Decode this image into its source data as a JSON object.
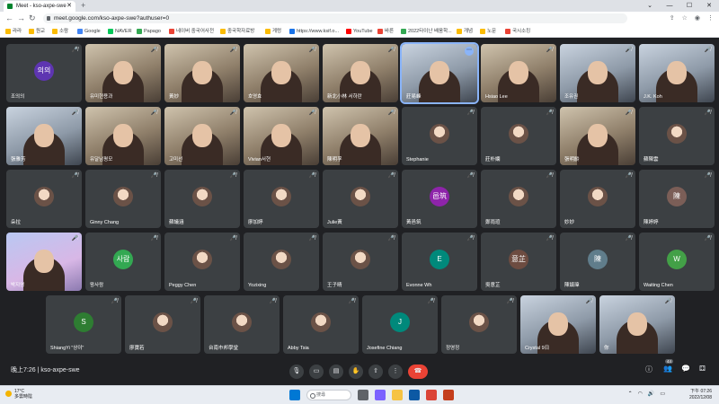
{
  "browser": {
    "tab_title": "Meet - kso-axpe-swe",
    "url": "meet.google.com/kso-axpe-swe?authuser=0",
    "bookmarks": [
      "라라",
      "원교",
      "소람",
      "Google",
      "NAVER",
      "Papago",
      "네이버 중국어사전",
      "중국학자료방",
      "게렁",
      "https://www.ksif.o...",
      "YouTube",
      "바른",
      "2022타이난 배움학...",
      "개념",
      "노문",
      "국시소킹"
    ]
  },
  "rows": [
    [
      {
        "type": "avatar",
        "initials": "의의",
        "color": "#5e35b1",
        "name": "조의의"
      },
      {
        "type": "video",
        "name": "유미현용과"
      },
      {
        "type": "video",
        "name": "黃妙"
      },
      {
        "type": "video",
        "name": "호영효"
      },
      {
        "type": "video",
        "name": "新北小林 서하란"
      },
      {
        "type": "video",
        "tone": "cool",
        "name": "莊易峰",
        "active": true
      },
      {
        "type": "video",
        "name": "Hsiao Lee"
      },
      {
        "type": "video",
        "tone": "cool",
        "name": "조유권"
      },
      {
        "type": "video",
        "tone": "cool",
        "name": "J.K. Koh"
      }
    ],
    [
      {
        "type": "video",
        "tone": "cool",
        "name": "張雅芳"
      },
      {
        "type": "video",
        "name": "유달남평모"
      },
      {
        "type": "video",
        "name": "고미선"
      },
      {
        "type": "video",
        "name": "Vivian서현"
      },
      {
        "type": "video",
        "name": "陳明孚"
      },
      {
        "type": "photo",
        "name": "Stephanie"
      },
      {
        "type": "photo",
        "name": "莊朴嫻"
      },
      {
        "type": "video",
        "name": "張明齡"
      },
      {
        "type": "photo",
        "name": "蘇陳雲"
      }
    ],
    [
      {
        "type": "photo",
        "name": "朵拉"
      },
      {
        "type": "photo",
        "name": "Ginny Chang"
      },
      {
        "type": "photo",
        "name": "蘇議涵"
      },
      {
        "type": "photo",
        "name": "廖加婷"
      },
      {
        "type": "photo",
        "name": "Julie黃"
      },
      {
        "type": "avatar",
        "initials": "邑筑",
        "color": "#8e24aa",
        "name": "黃邑筑"
      },
      {
        "type": "photo",
        "name": "鄭雨瑄"
      },
      {
        "type": "photo",
        "name": "妙妙"
      },
      {
        "type": "avatar",
        "initials": "陳",
        "color": "#7b5e57",
        "name": "陳婷婷"
      }
    ],
    [
      {
        "type": "video",
        "tone": "blue",
        "name": "박지영"
      },
      {
        "type": "avatar",
        "initials": "사람",
        "color": "#33a852",
        "name": "왕사람"
      },
      {
        "type": "photo",
        "name": "Peggy Chen"
      },
      {
        "type": "photo",
        "name": "Yozixing"
      },
      {
        "type": "photo",
        "name": "王子晴"
      },
      {
        "type": "avatar",
        "initials": "E",
        "color": "#00897b",
        "name": "Evonne Wh"
      },
      {
        "type": "avatar",
        "initials": "意芷",
        "color": "#6d4c41",
        "name": "吳意芷"
      },
      {
        "type": "avatar",
        "initials": "陳",
        "color": "#607d8b",
        "name": "陳鎮瑋"
      },
      {
        "type": "avatar",
        "initials": "W",
        "color": "#43a047",
        "name": "Waiting Chen"
      }
    ],
    [
      {
        "type": "avatar",
        "initials": "S",
        "color": "#2e7d32",
        "name": "ShiangYi \"샹이\""
      },
      {
        "type": "photo",
        "name": "廖寶若"
      },
      {
        "type": "photo",
        "name": "台南巿邦學堂"
      },
      {
        "type": "photo",
        "name": "Abby Tsia"
      },
      {
        "type": "avatar",
        "initials": "J",
        "color": "#00897b",
        "name": "Josefine Chiang"
      },
      {
        "type": "photo",
        "name": "정영정"
      },
      {
        "type": "video",
        "tone": "cool",
        "name": "Crystal 9日"
      },
      {
        "type": "video",
        "tone": "cool",
        "name": "你"
      }
    ]
  ],
  "controls": {
    "time_meeting": "晚上7:26 | kso-axpe-swe",
    "participant_count": "44"
  },
  "taskbar": {
    "weather_temp": "17°C",
    "weather_desc": "多雲時陰",
    "search_placeholder": "搜尋",
    "time": "下午 07:26",
    "date": "2022/12/08"
  }
}
